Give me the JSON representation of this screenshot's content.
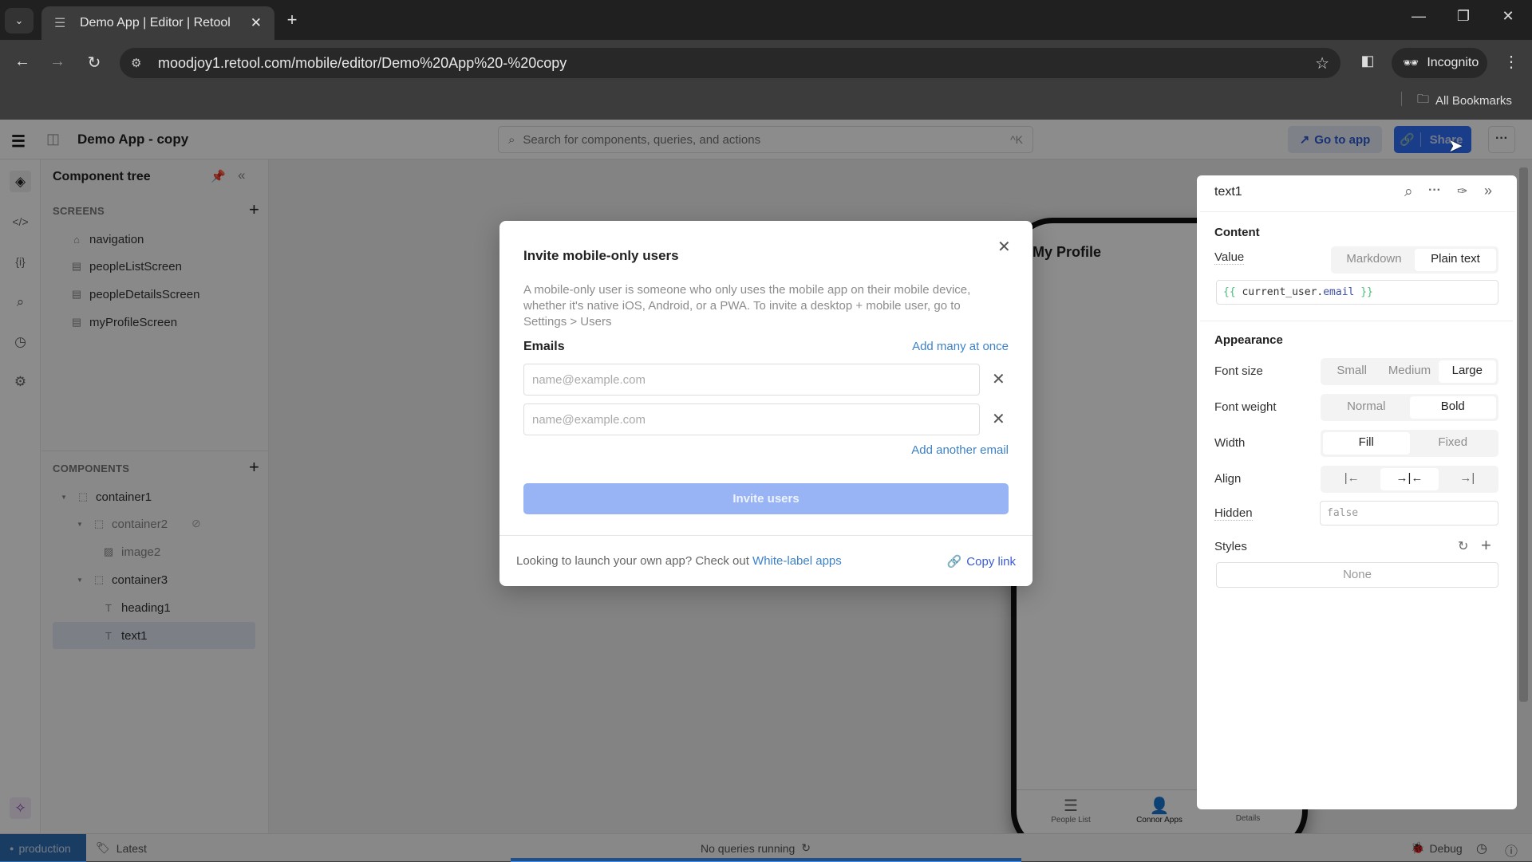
{
  "browser": {
    "tab_title": "Demo App | Editor | Retool",
    "url": "moodjoy1.retool.com/mobile/editor/Demo%20App%20-%20copy",
    "incognito_label": "Incognito",
    "bookmarks_label": "All Bookmarks"
  },
  "header": {
    "app_title": "Demo App - copy",
    "search_placeholder": "Search for components, queries, and actions",
    "search_shortcut": "^K",
    "go_to_app": "Go to app",
    "share": "Share"
  },
  "tree": {
    "title": "Component tree",
    "screens_label": "SCREENS",
    "screens": [
      "navigation",
      "peopleListScreen",
      "peopleDetailsScreen",
      "myProfileScreen"
    ],
    "components_label": "COMPONENTS",
    "components": [
      "container1",
      "container2",
      "image2",
      "container3",
      "heading1",
      "text1"
    ],
    "selected": "text1"
  },
  "phone": {
    "title": "My Profile",
    "nav": [
      "People List",
      "Connor Apps",
      "Details"
    ],
    "active_nav": "Connor Apps"
  },
  "modal": {
    "title": "Invite mobile-only users",
    "description": "A mobile-only user is someone who only uses the mobile app on their mobile device, whether it's native iOS, Android, or a PWA. To invite a desktop + mobile user, go to Settings > Users",
    "emails_label": "Emails",
    "add_many": "Add many at once",
    "email_placeholder": "name@example.com",
    "email_values": [
      "",
      ""
    ],
    "add_another": "Add another email",
    "invite_button": "Invite users",
    "footer_text": "Looking to launch your own app? Check out",
    "footer_link": "White-label apps",
    "copy_link": "Copy link"
  },
  "inspector": {
    "component_name": "text1",
    "content_label": "Content",
    "value_label": "Value",
    "value_modes": [
      "Markdown",
      "Plain text"
    ],
    "value_mode_selected": "Plain text",
    "value_code_open": "{{",
    "value_code_expr": "current_user.",
    "value_code_prop": "email",
    "value_code_close": "}}",
    "appearance_label": "Appearance",
    "font_size_label": "Font size",
    "font_sizes": [
      "Small",
      "Medium",
      "Large"
    ],
    "font_size_selected": "Large",
    "font_weight_label": "Font weight",
    "font_weights": [
      "Normal",
      "Bold"
    ],
    "font_weight_selected": "Bold",
    "width_label": "Width",
    "widths": [
      "Fill",
      "Fixed"
    ],
    "width_selected": "Fill",
    "align_label": "Align",
    "align_selected": "center",
    "hidden_label": "Hidden",
    "hidden_value": "false",
    "styles_label": "Styles",
    "styles_value": "None"
  },
  "status": {
    "environment": "production",
    "version": "Latest",
    "queries": "No queries running",
    "debug": "Debug"
  },
  "colors": {
    "accent": "#3170f9",
    "link": "#3d82c6",
    "invite_disabled": "#98b4f4",
    "production": "#2f6db5"
  }
}
